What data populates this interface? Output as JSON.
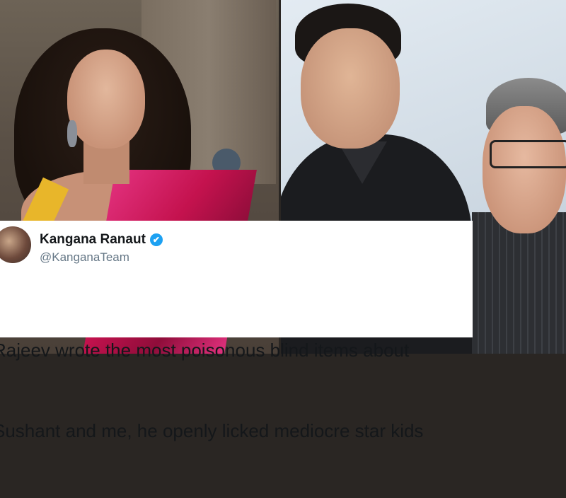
{
  "tweet": {
    "name": "Kangana Ranaut",
    "handle": "@KanganaTeam",
    "verified_icon": "verified-badge",
    "text_line1": "Rajeev wrote the most poisonous blind items about",
    "text_line2": "Sushant and me, he openly licked mediocre star kids"
  },
  "colors": {
    "verified_blue": "#1da1f2",
    "tweet_background": "#ffffff"
  }
}
